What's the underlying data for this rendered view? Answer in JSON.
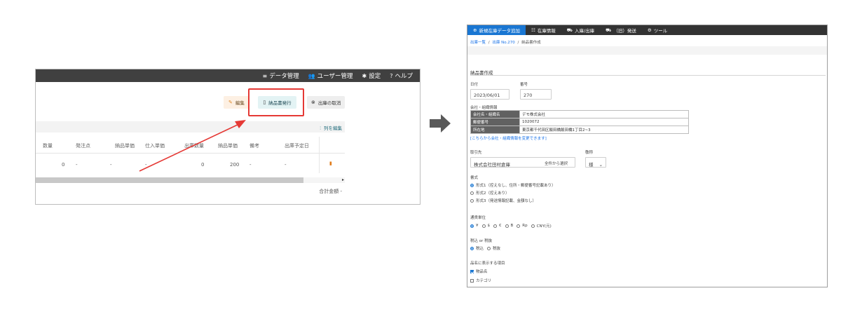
{
  "before": {
    "nav": [
      {
        "icon": "list-icon",
        "glyph": "≡",
        "label": "データ管理"
      },
      {
        "icon": "users-icon",
        "glyph": "👥",
        "label": "ユーザー管理"
      },
      {
        "icon": "gear-icon",
        "glyph": "✱",
        "label": "設定"
      },
      {
        "icon": "help-icon",
        "glyph": "?",
        "label": "ヘルプ"
      }
    ],
    "actions": {
      "edit_label": "編集",
      "issue_delivery_label": "納品書発行",
      "cancel_shipment_label": "出庫の取消"
    },
    "table": {
      "column_edit_label": "列を編集",
      "headers": [
        "数量",
        "発注点",
        "納品単価",
        "仕入単価",
        "出庫数量",
        "納品単価",
        "備考",
        "出庫予定日"
      ],
      "row": [
        "0",
        "-",
        "-",
        "-",
        "0",
        "200",
        "-",
        "-"
      ],
      "total_label": "合計金額 -"
    }
  },
  "after": {
    "nav": [
      {
        "icon": "plus-circle-icon",
        "glyph": "⊕",
        "label": "新規在庫データ追加",
        "active": true
      },
      {
        "icon": "list-icon",
        "glyph": "☷",
        "label": "在庫情報",
        "active": false
      },
      {
        "icon": "cart-icon",
        "glyph": "⛟",
        "label": "入庫/出庫",
        "active": false
      },
      {
        "icon": "truck-icon",
        "glyph": "⛟",
        "label": "（旧）発送",
        "active": false
      },
      {
        "icon": "tools-icon",
        "glyph": "⚙",
        "label": "ツール",
        "active": false
      }
    ],
    "breadcrumb": {
      "link1": "出庫一覧",
      "link2": "出庫 No.270",
      "current": "納品書作成",
      "separator": "/"
    },
    "form": {
      "title": "納品書作成",
      "date_label": "日付",
      "date_value": "2023/06/01",
      "number_label": "番号",
      "number_value": "270",
      "company_section_label": "会社・組織情報",
      "company_rows": [
        {
          "label": "会社名・組織名",
          "value": "デモ株式会社"
        },
        {
          "label": "郵便番号",
          "value": "1020072"
        },
        {
          "label": "所在地",
          "value": "東京都千代田区飯田橋飯田橋1丁目2~3"
        }
      ],
      "change_link": "[こちらから会社・組織情報を変更できます]",
      "client_label": "取引先",
      "client_value": "株式会社田村倉庫",
      "select_from_all": "全件から選択",
      "honorific_label": "敬称",
      "honorific_value": "様",
      "format_label": "書式",
      "format_options": [
        {
          "label": "形式1（控えなし、住所・郵便番号記載あり）",
          "checked": true
        },
        {
          "label": "形式2（控えあり）",
          "checked": false
        },
        {
          "label": "形式3（発送情報記載、金額なし）",
          "checked": false
        }
      ],
      "currency_label": "通貨単位",
      "currency_options": [
        {
          "label": "¥",
          "checked": true
        },
        {
          "label": "$",
          "checked": false
        },
        {
          "label": "€",
          "checked": false
        },
        {
          "label": "B",
          "checked": false
        },
        {
          "label": "Rp",
          "checked": false
        },
        {
          "label": "CNY(元)",
          "checked": false
        }
      ],
      "tax_label": "税込 or 税抜",
      "tax_options": [
        {
          "label": "税込",
          "checked": true
        },
        {
          "label": "税抜",
          "checked": false
        }
      ],
      "items_label": "品名に表示する項目",
      "items_options": [
        {
          "label": "物品名",
          "checked": true
        },
        {
          "label": "カテゴリ",
          "checked": false
        }
      ]
    }
  },
  "colors": {
    "nav_dark": "#404040",
    "nav_active": "#1976d2",
    "highlight": "#e53935",
    "link": "#1a73e8"
  }
}
